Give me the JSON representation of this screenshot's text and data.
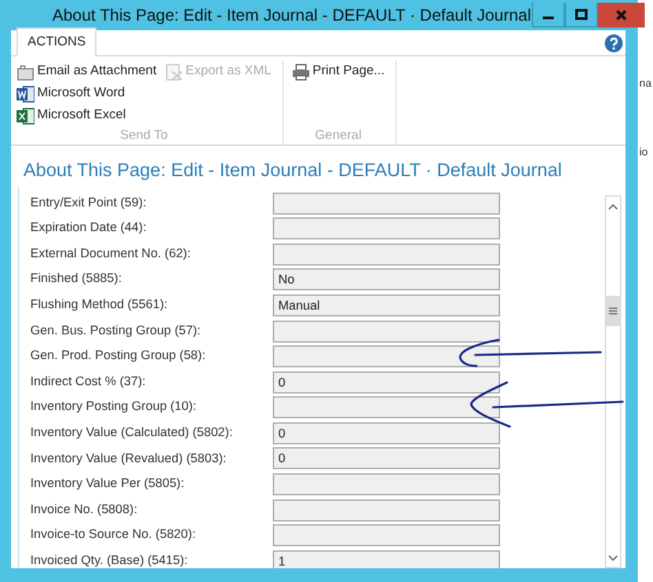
{
  "window": {
    "title": "About This Page: Edit - Item Journal - DEFAULT · Default Journal"
  },
  "ribbon": {
    "tabs": [
      {
        "label": "ACTIONS",
        "selected": true
      }
    ],
    "groups": [
      {
        "label": "Send To",
        "actions": [
          {
            "kind": "email",
            "label": "Email as Attachment",
            "disabled": false
          },
          {
            "kind": "word",
            "label": "Microsoft Word",
            "disabled": false
          },
          {
            "kind": "excel",
            "label": "Microsoft Excel",
            "disabled": false
          },
          {
            "kind": "export",
            "label": "Export as XML",
            "disabled": true
          }
        ]
      },
      {
        "label": "General",
        "actions": [
          {
            "kind": "print",
            "label": "Print Page...",
            "disabled": false
          }
        ]
      }
    ]
  },
  "page_heading": "About This Page: Edit - Item Journal - DEFAULT · Default Journal",
  "fields": [
    {
      "label": "Entry/Exit Point (59):"
    },
    {
      "label": "Expiration Date (44):"
    },
    {
      "label": "External Document No. (62):"
    },
    {
      "label": "Finished (5885):",
      "value": "No"
    },
    {
      "label": "Flushing Method (5561):",
      "value": "Manual"
    },
    {
      "label": "Gen. Bus. Posting Group (57):"
    },
    {
      "label": "Gen. Prod. Posting Group (58):"
    },
    {
      "label": "Indirect Cost % (37):",
      "value": "0"
    },
    {
      "label": "Inventory Posting Group (10):"
    },
    {
      "label": "Inventory Value (Calculated) (5802):",
      "value": "0"
    },
    {
      "label": "Inventory Value (Revalued) (5803):",
      "value": "0"
    },
    {
      "label": "Inventory Value Per (5805):"
    },
    {
      "label": "Invoice No. (5808):"
    },
    {
      "label": "Invoice-to Source No. (5820):"
    },
    {
      "label": "Invoiced Qty. (Base) (5415):",
      "value": "1"
    }
  ],
  "background_fragments": [
    "na",
    "io"
  ]
}
